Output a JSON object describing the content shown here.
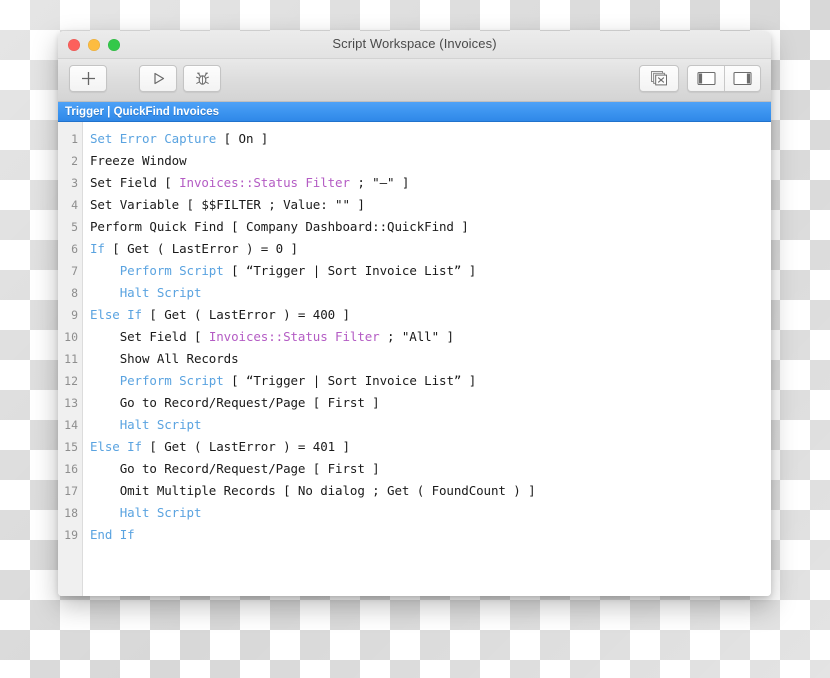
{
  "window": {
    "title": "Script Workspace (Invoices)",
    "traffic_lights": [
      {
        "name": "close",
        "color": "#fc605c"
      },
      {
        "name": "minimize",
        "color": "#fdbc40"
      },
      {
        "name": "zoom",
        "color": "#34c84a"
      }
    ]
  },
  "toolbar": {
    "new_script_label": "+",
    "buttons": [
      {
        "name": "new-script",
        "icon": "plus-icon",
        "tooltip": "New Script"
      },
      {
        "name": "run-script",
        "icon": "play-triangle-icon",
        "tooltip": "Run"
      },
      {
        "name": "debug-script",
        "icon": "bug-icon",
        "tooltip": "Debug"
      },
      {
        "name": "close-all-scripts",
        "icon": "close-all-windows-icon",
        "tooltip": "Close All"
      },
      {
        "name": "toggle-left-pane",
        "icon": "left-sidebar-icon",
        "tooltip": "Show Left Pane"
      },
      {
        "name": "toggle-right-pane",
        "icon": "right-sidebar-icon",
        "tooltip": "Show Right Pane"
      }
    ]
  },
  "tabs": [
    {
      "label": "Trigger | QuickFind Invoices",
      "active": true
    }
  ],
  "colors": {
    "tab_blue": "#3d95f0",
    "keyword_blue": "#5aa3e0",
    "field_purple": "#b45cc4",
    "text_black": "#1a1a1a",
    "gutter_gray": "#f0f0f0"
  },
  "script": {
    "name": "Trigger | QuickFind Invoices",
    "lines": [
      {
        "num": "1",
        "indent": 0,
        "tokens": [
          {
            "t": "kw",
            "v": "Set Error Capture"
          },
          {
            "t": "plain",
            "v": " [ On ]"
          }
        ]
      },
      {
        "num": "2",
        "indent": 0,
        "tokens": [
          {
            "t": "plain",
            "v": "Freeze Window"
          }
        ]
      },
      {
        "num": "3",
        "indent": 0,
        "tokens": [
          {
            "t": "plain",
            "v": "Set Field [ "
          },
          {
            "t": "field",
            "v": "Invoices::Status Filter"
          },
          {
            "t": "plain",
            "v": " ; \"–\" ]"
          }
        ]
      },
      {
        "num": "4",
        "indent": 0,
        "tokens": [
          {
            "t": "plain",
            "v": "Set Variable [ $$FILTER ; Value: \"\" ]"
          }
        ]
      },
      {
        "num": "5",
        "indent": 0,
        "tokens": [
          {
            "t": "plain",
            "v": "Perform Quick Find [ Company Dashboard::QuickFind ]"
          }
        ]
      },
      {
        "num": "6",
        "indent": 0,
        "tokens": [
          {
            "t": "kw",
            "v": "If"
          },
          {
            "t": "plain",
            "v": " [ Get ( LastError ) = 0 ]"
          }
        ]
      },
      {
        "num": "7",
        "indent": 1,
        "tokens": [
          {
            "t": "kw",
            "v": "Perform Script"
          },
          {
            "t": "plain",
            "v": " [ “Trigger | Sort Invoice List” ]"
          }
        ]
      },
      {
        "num": "8",
        "indent": 1,
        "tokens": [
          {
            "t": "kw",
            "v": "Halt Script"
          }
        ]
      },
      {
        "num": "9",
        "indent": 0,
        "tokens": [
          {
            "t": "kw",
            "v": "Else If"
          },
          {
            "t": "plain",
            "v": " [ Get ( LastError ) = 400 ]"
          }
        ]
      },
      {
        "num": "10",
        "indent": 1,
        "tokens": [
          {
            "t": "plain",
            "v": "Set Field [ "
          },
          {
            "t": "field",
            "v": "Invoices::Status Filter"
          },
          {
            "t": "plain",
            "v": " ; \"All\" ]"
          }
        ]
      },
      {
        "num": "11",
        "indent": 1,
        "tokens": [
          {
            "t": "plain",
            "v": "Show All Records"
          }
        ]
      },
      {
        "num": "12",
        "indent": 1,
        "tokens": [
          {
            "t": "kw",
            "v": "Perform Script"
          },
          {
            "t": "plain",
            "v": " [ “Trigger | Sort Invoice List” ]"
          }
        ]
      },
      {
        "num": "13",
        "indent": 1,
        "tokens": [
          {
            "t": "plain",
            "v": "Go to Record/Request/Page [ First ]"
          }
        ]
      },
      {
        "num": "14",
        "indent": 1,
        "tokens": [
          {
            "t": "kw",
            "v": "Halt Script"
          }
        ]
      },
      {
        "num": "15",
        "indent": 0,
        "tokens": [
          {
            "t": "kw",
            "v": "Else If"
          },
          {
            "t": "plain",
            "v": " [ Get ( LastError ) = 401 ]"
          }
        ]
      },
      {
        "num": "16",
        "indent": 1,
        "tokens": [
          {
            "t": "plain",
            "v": "Go to Record/Request/Page [ First ]"
          }
        ]
      },
      {
        "num": "17",
        "indent": 1,
        "tokens": [
          {
            "t": "plain",
            "v": "Omit Multiple Records [ No dialog ; Get ( FoundCount ) ]"
          }
        ]
      },
      {
        "num": "18",
        "indent": 1,
        "tokens": [
          {
            "t": "kw",
            "v": "Halt Script"
          }
        ]
      },
      {
        "num": "19",
        "indent": 0,
        "tokens": [
          {
            "t": "kw",
            "v": "End If"
          }
        ]
      }
    ]
  }
}
